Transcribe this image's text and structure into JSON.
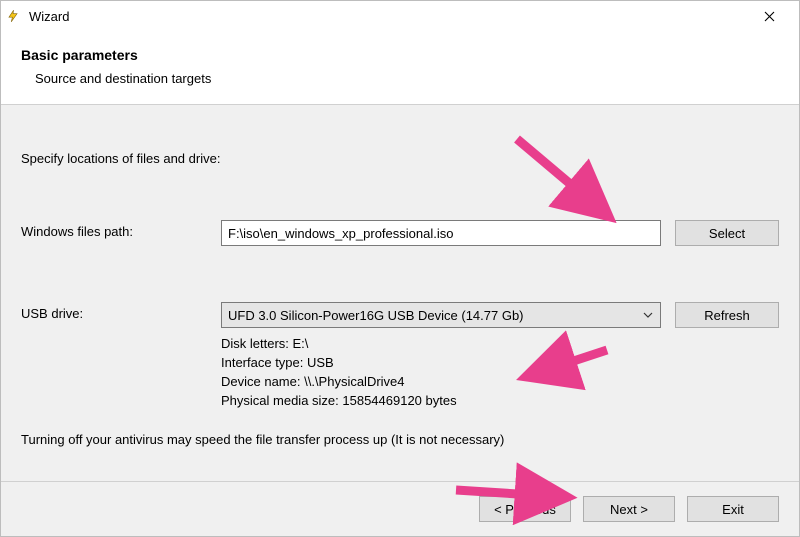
{
  "window": {
    "title": "Wizard"
  },
  "header": {
    "title": "Basic parameters",
    "subtitle": "Source and destination targets"
  },
  "content": {
    "instruction": "Specify locations of files and drive:",
    "files_label": "Windows files path:",
    "files_value": "F:\\iso\\en_windows_xp_professional.iso",
    "select_label": "Select",
    "usb_label": "USB drive:",
    "usb_value": "UFD 3.0 Silicon-Power16G USB Device (14.77 Gb)",
    "refresh_label": "Refresh",
    "info1": "Disk letters: E:\\",
    "info2": "Interface type: USB",
    "info3": "Device name: \\\\.\\PhysicalDrive4",
    "info4": "Physical media size: 15854469120 bytes",
    "note": "Turning off your antivirus may speed the file transfer process up (It is not necessary)"
  },
  "footer": {
    "prev": "< Previous",
    "next": "Next >",
    "exit": "Exit"
  }
}
